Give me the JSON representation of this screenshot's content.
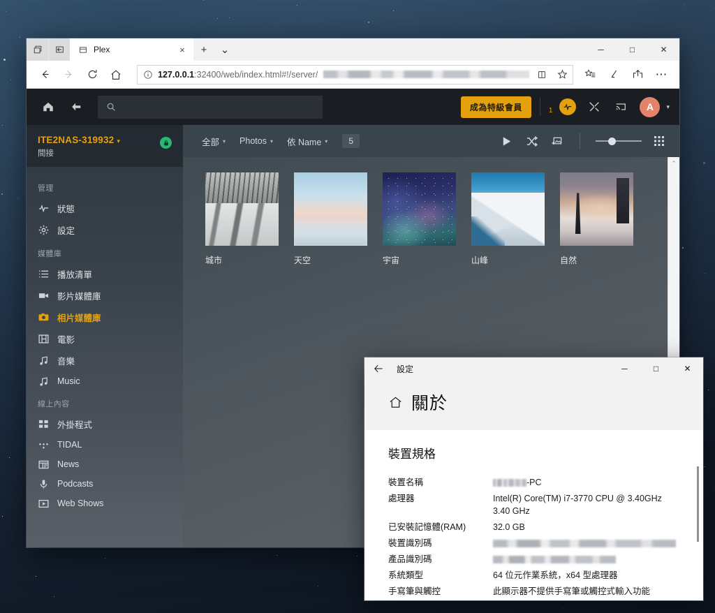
{
  "browser": {
    "tab_buttons": {
      "tab_overview": "tab-overview-icon",
      "set_aside": "set-tabs-aside-icon"
    },
    "tab": {
      "title": "Plex",
      "close": "×"
    },
    "new_tab": "+",
    "tab_menu": "⌄",
    "window_controls": {
      "minimize": "─",
      "maximize": "□",
      "close": "✕"
    },
    "nav": {
      "back": "←",
      "forward": "→",
      "refresh": "↻",
      "home": "⌂"
    },
    "omnibox": {
      "info_icon": "info-circle-icon",
      "url_bold": "127.0.0.1",
      "url_rest": ":32400/web/index.html#!/server/",
      "reading_view_icon": "reading-view-icon",
      "favorite_icon": "star-icon"
    },
    "toolbar_icons": {
      "favorites": "favorites-list-icon",
      "collections": "notes-pen-icon",
      "share": "share-icon",
      "settings_more": "⋯"
    }
  },
  "plex": {
    "topbar": {
      "home_icon": "home-icon",
      "back_icon": "back-arrow-icon",
      "search_placeholder": "",
      "search_value": "",
      "premium_label": "成為特級會員",
      "notification_count": "1",
      "activity_icon": "activity-pulse-icon",
      "tools_icon": "wrench-screwdriver-icon",
      "cast_icon": "cast-icon",
      "avatar_initial": "A",
      "avatar_caret": "▾"
    },
    "sidebar": {
      "server_name": "ITE2NAS-319932",
      "server_caret": "▾",
      "server_status": "間接",
      "lock_icon": "secure-lock-icon",
      "groups": [
        {
          "label": "管理",
          "items": [
            {
              "label": "狀態",
              "icon": "activity-status-icon",
              "active": false
            },
            {
              "label": "設定",
              "icon": "gear-icon",
              "active": false
            }
          ]
        },
        {
          "label": "媒體庫",
          "items": [
            {
              "label": "播放清單",
              "icon": "playlist-icon",
              "active": false
            },
            {
              "label": "影片媒體庫",
              "icon": "video-camera-icon",
              "active": false
            },
            {
              "label": "相片媒體庫",
              "icon": "camera-icon",
              "active": true
            },
            {
              "label": "電影",
              "icon": "film-icon",
              "active": false
            },
            {
              "label": "音樂",
              "icon": "music-note-icon",
              "active": false
            },
            {
              "label": "Music",
              "icon": "music-note-icon",
              "active": false
            }
          ]
        },
        {
          "label": "線上內容",
          "items": [
            {
              "label": "外掛程式",
              "icon": "apps-grid-icon",
              "active": false
            },
            {
              "label": "TIDAL",
              "icon": "tidal-icon",
              "active": false
            },
            {
              "label": "News",
              "icon": "news-icon",
              "active": false
            },
            {
              "label": "Podcasts",
              "icon": "microphone-icon",
              "active": false
            },
            {
              "label": "Web Shows",
              "icon": "play-box-icon",
              "active": false
            }
          ]
        }
      ]
    },
    "toolbar": {
      "filter_all": "全部",
      "filter_type": "Photos",
      "filter_sort": "依 Name",
      "caret": "▾",
      "item_count": "5",
      "play_icon": "play-icon",
      "shuffle_icon": "shuffle-icon",
      "add_photo_icon": "add-to-library-icon",
      "grid_view_icon": "grid-view-icon",
      "zoom_slider_value": "30"
    },
    "photos": [
      {
        "title": "城市",
        "art": "art-city"
      },
      {
        "title": "天空",
        "art": "art-sky"
      },
      {
        "title": "宇宙",
        "art": "art-space"
      },
      {
        "title": "山峰",
        "art": "art-mount"
      },
      {
        "title": "自然",
        "art": "art-nature"
      }
    ],
    "scrollbar_up": "⌃"
  },
  "settings": {
    "titlebar": {
      "back_icon": "back-arrow-icon",
      "title": "設定",
      "minimize": "─",
      "maximize": "□",
      "close": "✕"
    },
    "home_icon": "home-icon",
    "page_title": "關於",
    "section_title": "裝置規格",
    "specs": [
      {
        "key": "裝置名稱",
        "value": "-PC",
        "blurred": true,
        "blur_width": 48,
        "dim": false
      },
      {
        "key": "處理器",
        "value": "Intel(R) Core(TM) i7-3770 CPU @ 3.40GHz 3.40 GHz",
        "blurred": false,
        "dim": false
      },
      {
        "key": "已安裝記憶體(RAM)",
        "value": "32.0 GB",
        "blurred": false,
        "dim": false
      },
      {
        "key": "裝置識別碼",
        "value": "",
        "blurred": true,
        "blur_width": 262,
        "dim": false
      },
      {
        "key": "產品識別碼",
        "value": "",
        "blurred": true,
        "blur_width": 176,
        "dim": false
      },
      {
        "key": "系統類型",
        "value": "64 位元作業系統，x64 型處理器",
        "blurred": false,
        "dim": false
      },
      {
        "key": "手寫筆與觸控",
        "value": "此顯示器不提供手寫筆或觸控式輸入功能",
        "blurred": false,
        "dim": true
      }
    ]
  },
  "colors": {
    "plex_accent": "#e5a00d",
    "avatar_bg": "#e5836a",
    "lock_green": "#2bb673",
    "sidebar_top": "#2f383f"
  }
}
